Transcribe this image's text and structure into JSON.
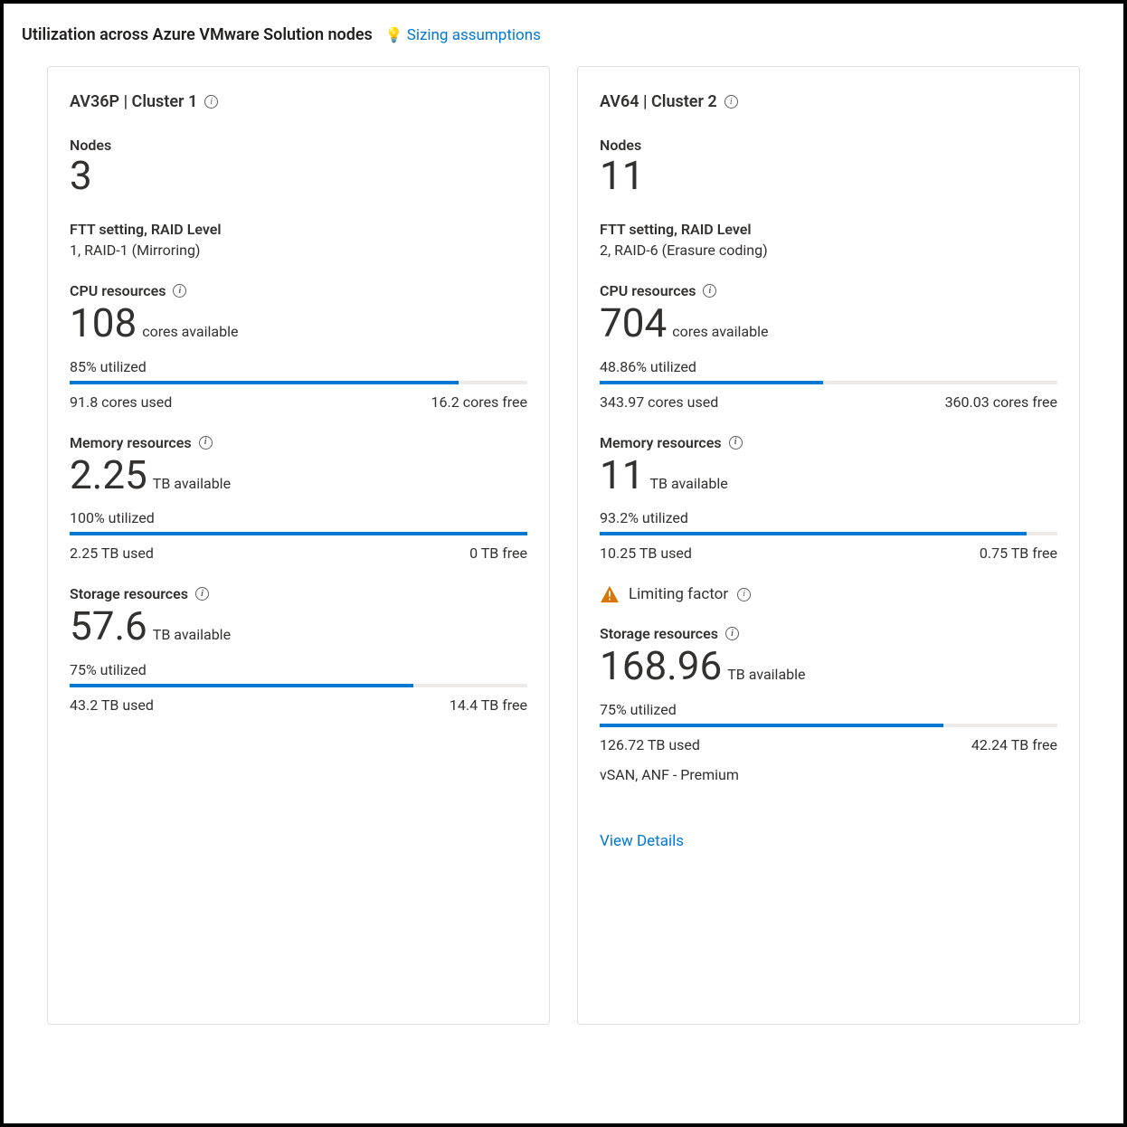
{
  "header": {
    "title": "Utilization across Azure VMware Solution nodes",
    "link": "Sizing assumptions"
  },
  "clusters": [
    {
      "title": "AV36P | Cluster 1",
      "nodes_label": "Nodes",
      "nodes": "3",
      "ftt_label": "FTT setting, RAID Level",
      "ftt_value": "1, RAID-1 (Mirroring)",
      "cpu": {
        "label": "CPU resources",
        "value": "108",
        "unit": "cores available",
        "utilized": "85% utilized",
        "pct": 85,
        "used": "91.8 cores used",
        "free": "16.2 cores free"
      },
      "memory": {
        "label": "Memory resources",
        "value": "2.25",
        "unit": "TB available",
        "utilized": "100% utilized",
        "pct": 100,
        "used": "2.25 TB used",
        "free": "0 TB free"
      },
      "storage": {
        "label": "Storage resources",
        "value": "57.6",
        "unit": "TB available",
        "utilized": "75% utilized",
        "pct": 75,
        "used": "43.2 TB used",
        "free": "14.4 TB free"
      }
    },
    {
      "title": "AV64 | Cluster 2",
      "nodes_label": "Nodes",
      "nodes": "11",
      "ftt_label": "FTT setting, RAID Level",
      "ftt_value": "2, RAID-6 (Erasure coding)",
      "cpu": {
        "label": "CPU resources",
        "value": "704",
        "unit": "cores available",
        "utilized": "48.86% utilized",
        "pct": 48.86,
        "used": "343.97 cores used",
        "free": "360.03 cores free"
      },
      "memory": {
        "label": "Memory resources",
        "value": "11",
        "unit": "TB available",
        "utilized": "93.2% utilized",
        "pct": 93.2,
        "used": "10.25 TB used",
        "free": "0.75 TB free"
      },
      "limiting": "Limiting factor",
      "storage": {
        "label": "Storage resources",
        "value": "168.96",
        "unit": "TB available",
        "utilized": "75% utilized",
        "pct": 75,
        "used": "126.72 TB used",
        "free": "42.24 TB free",
        "note": "vSAN, ANF - Premium"
      },
      "view_details": "View Details"
    }
  ]
}
